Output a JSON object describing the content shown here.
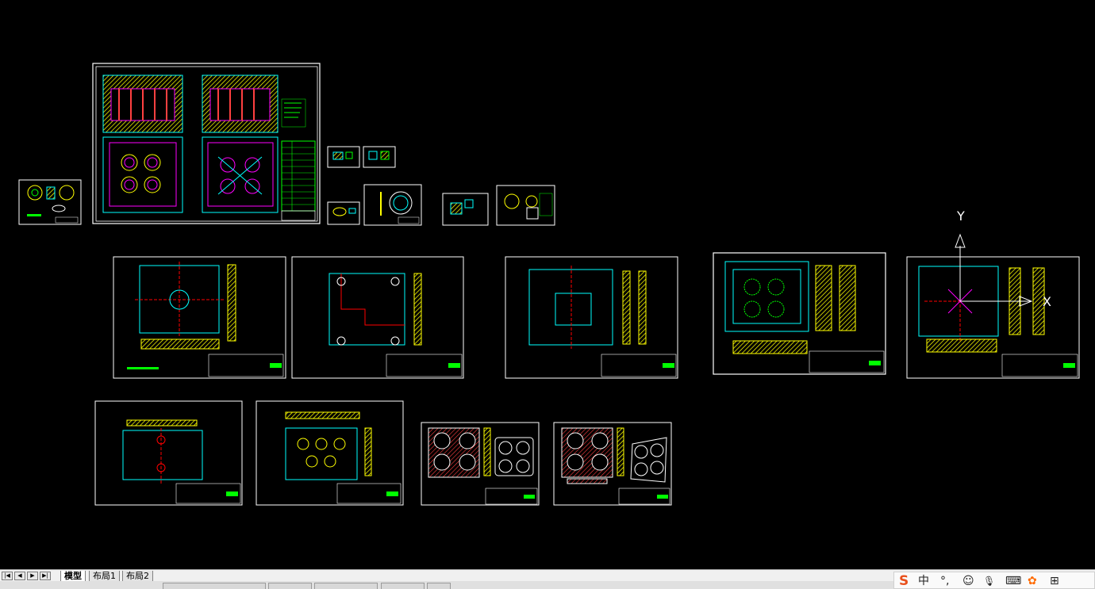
{
  "tabs": {
    "model": "模型",
    "layout1": "布局1",
    "layout2": "布局2"
  },
  "ucs": {
    "y_label": "Y",
    "x_label": "X"
  },
  "ime": {
    "logo": "S",
    "chinese": "中",
    "punct": "°,",
    "emoji": "☺",
    "mic": "🎙",
    "keyboard": "⌨",
    "skin": "✿",
    "menu": "⊞"
  },
  "colors": {
    "background": "#000000",
    "frame": "#ffffff",
    "cyan": "#00ffff",
    "yellow": "#ffff00",
    "green": "#00ff00",
    "red": "#ff0000",
    "magenta": "#ff00ff"
  }
}
